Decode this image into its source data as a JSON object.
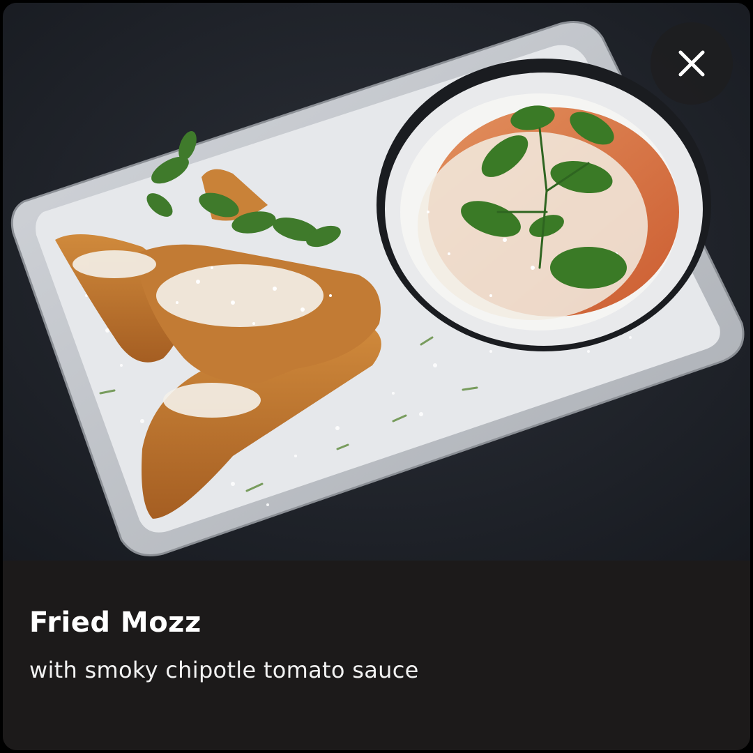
{
  "card": {
    "title": "Fried Mozz",
    "description": "with smoky chipotle tomato sauce"
  },
  "photo": {
    "subject": "food-photo"
  },
  "close": {
    "icon": "close-icon"
  },
  "colors": {
    "caption_background": "#1c1a1a",
    "close_background": "#1e1e20",
    "text": "#ffffff"
  }
}
